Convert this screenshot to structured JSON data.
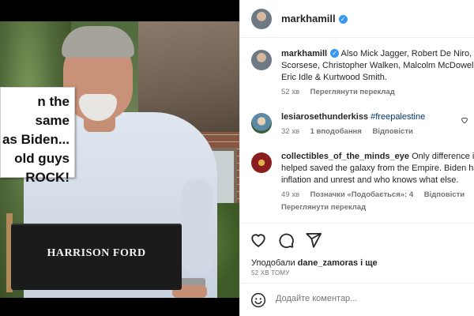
{
  "post": {
    "sign_text": "n the same\nas Biden...\nold guys\nROCK!",
    "chair_label": "HARRISON FORD"
  },
  "header": {
    "username": "markhamill",
    "verified_icon": "verified-badge-icon"
  },
  "comments": [
    {
      "username": "markhamill",
      "verified": true,
      "lines": [
        "Also Mick Jagger, Robert De Niro, Jo",
        "Scorsese, Christopher Walken, Malcolm McDowell, I",
        "Eric Idle & Kurtwood Smith."
      ],
      "time": "52 хв",
      "translate": "Переглянути переклад"
    },
    {
      "username": "lesiarosethunderkiss",
      "hashtag": "#freepalestine",
      "time": "32 хв",
      "likes": "1 вподобання",
      "reply": "Відповісти"
    },
    {
      "username": "collectibles_of_the_minds_eye",
      "lines": [
        "Only difference is th",
        "helped saved the galaxy from the Empire. Biden has",
        "inflation and unrest and who knows what else."
      ],
      "time": "49 хв",
      "likes": "Позначки «Подобається»: 4",
      "reply": "Відповісти",
      "translate": "Переглянути переклад"
    }
  ],
  "actions": {
    "liked_by_prefix": "Уподобали",
    "liked_by_user": "dane_zamoras",
    "liked_by_suffix": "і ще",
    "timestamp": "52 ХВ ТОМУ"
  },
  "comment_box": {
    "placeholder": "Додайте коментар..."
  },
  "colors": {
    "text": "#262626",
    "secondary": "#737373",
    "verified": "#3797f0",
    "link": "#00376b"
  }
}
